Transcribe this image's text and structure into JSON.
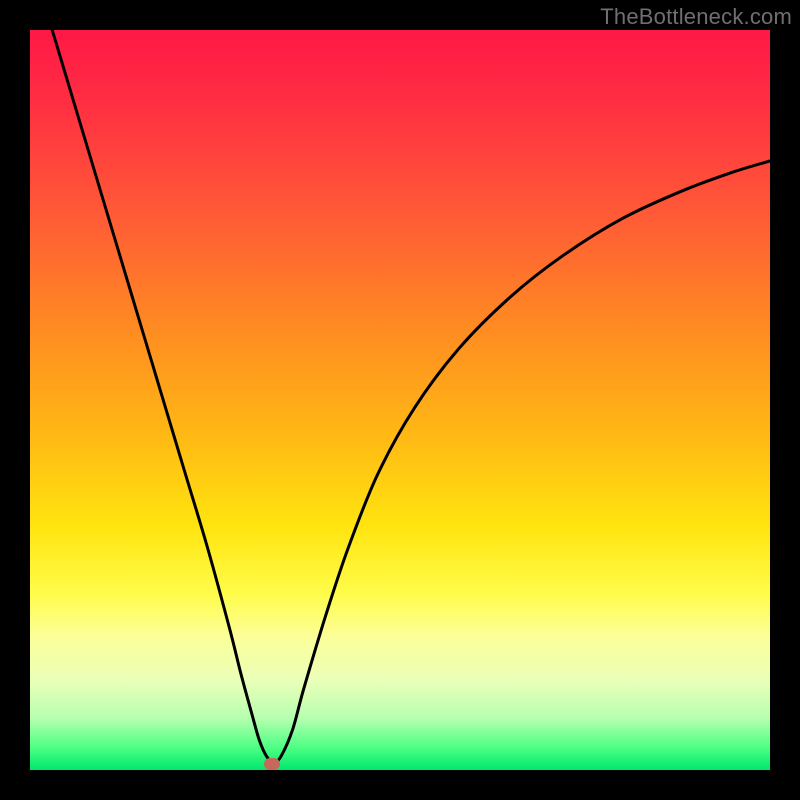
{
  "watermark": {
    "text": "TheBottleneck.com"
  },
  "marker": {
    "x_frac": 0.327,
    "y_frac": 0.992,
    "color": "#c46a5a"
  },
  "chart_data": {
    "type": "line",
    "title": "",
    "xlabel": "",
    "ylabel": "",
    "xlim": [
      0,
      1
    ],
    "ylim": [
      0,
      1
    ],
    "legend": false,
    "grid": false,
    "series": [
      {
        "name": "bottleneck-curve",
        "x": [
          0.03,
          0.06,
          0.09,
          0.12,
          0.15,
          0.18,
          0.21,
          0.24,
          0.27,
          0.285,
          0.3,
          0.31,
          0.32,
          0.33,
          0.34,
          0.355,
          0.37,
          0.4,
          0.43,
          0.47,
          0.52,
          0.58,
          0.65,
          0.72,
          0.8,
          0.88,
          0.95,
          1.0
        ],
        "y": [
          1.0,
          0.9,
          0.8,
          0.7,
          0.6,
          0.5,
          0.4,
          0.3,
          0.19,
          0.13,
          0.075,
          0.04,
          0.018,
          0.01,
          0.02,
          0.055,
          0.11,
          0.21,
          0.3,
          0.4,
          0.49,
          0.57,
          0.64,
          0.695,
          0.745,
          0.782,
          0.808,
          0.823
        ]
      }
    ],
    "annotations": [
      {
        "type": "marker",
        "x": 0.327,
        "y": 0.008,
        "color": "#c46a5a",
        "shape": "rounded-rect"
      }
    ],
    "background_gradient": {
      "direction": "vertical",
      "stops": [
        {
          "pos": 0.0,
          "color": "#ff1846"
        },
        {
          "pos": 0.1,
          "color": "#ff2f42"
        },
        {
          "pos": 0.25,
          "color": "#ff5a36"
        },
        {
          "pos": 0.4,
          "color": "#ff8a22"
        },
        {
          "pos": 0.55,
          "color": "#ffb914"
        },
        {
          "pos": 0.67,
          "color": "#ffe40f"
        },
        {
          "pos": 0.76,
          "color": "#fffc48"
        },
        {
          "pos": 0.82,
          "color": "#fcff99"
        },
        {
          "pos": 0.88,
          "color": "#e9ffb8"
        },
        {
          "pos": 0.93,
          "color": "#b6ffb0"
        },
        {
          "pos": 0.97,
          "color": "#4cff83"
        },
        {
          "pos": 1.0,
          "color": "#00e76e"
        }
      ]
    }
  }
}
